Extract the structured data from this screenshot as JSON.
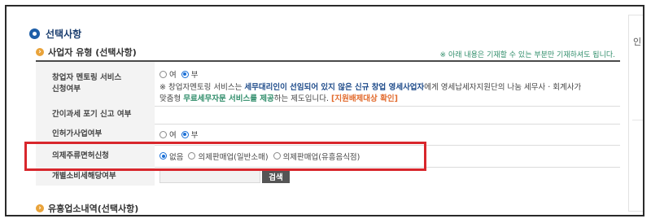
{
  "section": {
    "title": "선택사항"
  },
  "business_type": {
    "title": "사업자 유형 (선택사항)",
    "note_right": "※ 아래 내용은 기재할 수 있는 부분만 기재하셔도 됩니다."
  },
  "rows": {
    "mentoring": {
      "label_line1": "창업자 멘토링 서비스",
      "label_line2": "신청여부",
      "options": [
        "여",
        "부"
      ],
      "selected": "부",
      "note": {
        "p1": "※ 창업자멘토링 서비스는 ",
        "b1": "세무대리인이 선임되어 있지 않은 신규 창업 영세사업자",
        "p2": "에게 영세납세자지원단의 나눔 세무사 · 회계사가",
        "p3": "맞춤형 ",
        "b2": "무료세무자문 서비스를 제공",
        "p4": "하는 제도입니다. ",
        "b3": "[지원배제대상 확인]"
      }
    },
    "simplified_tax": {
      "label": "간이과세 포기 신고 여부"
    },
    "license": {
      "label": "인허가사업여부",
      "options": [
        "여",
        "부"
      ],
      "selected": "부"
    },
    "liquor": {
      "label": "의제주류면허신청",
      "options": [
        "없음",
        "의제판매업(일반소매)",
        "의제판매업(유흥음식점)"
      ],
      "selected": "없음"
    },
    "excise": {
      "label": "개별소비세해당여부",
      "search_label": "검색"
    }
  },
  "entertainment": {
    "title": "유흥업소내역(선택사항)"
  },
  "right_panel": {
    "char": "인"
  },
  "colors": {
    "highlight": "#d8262c",
    "accent_blue": "#1e5fa8",
    "note_green": "#2f8d6a",
    "link_orange": "#e26a2c"
  }
}
